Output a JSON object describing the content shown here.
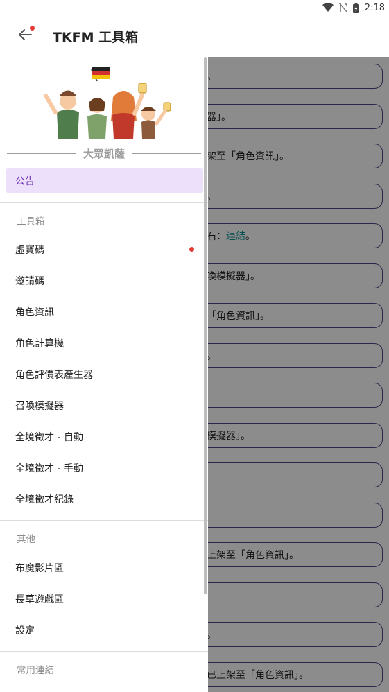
{
  "status_bar": {
    "time": "2:18"
  },
  "app_bar": {
    "title": "TKFM 工具箱"
  },
  "background_rows": [
    {
      "text": "。"
    },
    {
      "text": "器」。"
    },
    {
      "text": "架至「角色資訊」。"
    },
    {
      "text": "。"
    },
    {
      "text": "石：",
      "link": "連結",
      "suffix": "。"
    },
    {
      "text": "喚模擬器」。"
    },
    {
      "text": "「角色資訊」。"
    },
    {
      "text": "。"
    },
    {
      "text": ""
    },
    {
      "text": "模擬器」。"
    },
    {
      "text": ""
    },
    {
      "text": ""
    },
    {
      "text": "上架至「角色資訊」。"
    },
    {
      "text": ""
    },
    {
      "text": "。"
    },
    {
      "text": "已上架至「角色資訊」。"
    }
  ],
  "drawer": {
    "banner_caption": "大眾凱薩",
    "active_item": "公告",
    "sections": [
      {
        "header": "工具箱",
        "items": [
          {
            "label": "虛寶碼",
            "badge": true
          },
          {
            "label": "邀請碼"
          },
          {
            "label": "角色資訊"
          },
          {
            "label": "角色計算機"
          },
          {
            "label": "角色評價表產生器"
          },
          {
            "label": "召喚模擬器"
          },
          {
            "label": "全境徵才 - 自動"
          },
          {
            "label": "全境徵才 - 手動"
          },
          {
            "label": "全境徵才紀錄"
          }
        ]
      },
      {
        "header": "其他",
        "items": [
          {
            "label": "布魔影片區"
          },
          {
            "label": "長草遊戲區"
          },
          {
            "label": "設定"
          }
        ]
      },
      {
        "header": "常用連結",
        "items": []
      }
    ]
  },
  "colors": {
    "accent": "#6a2bb0",
    "active_bg": "#ede0fb",
    "badge": "#e53935",
    "link": "#0a8f8f"
  }
}
